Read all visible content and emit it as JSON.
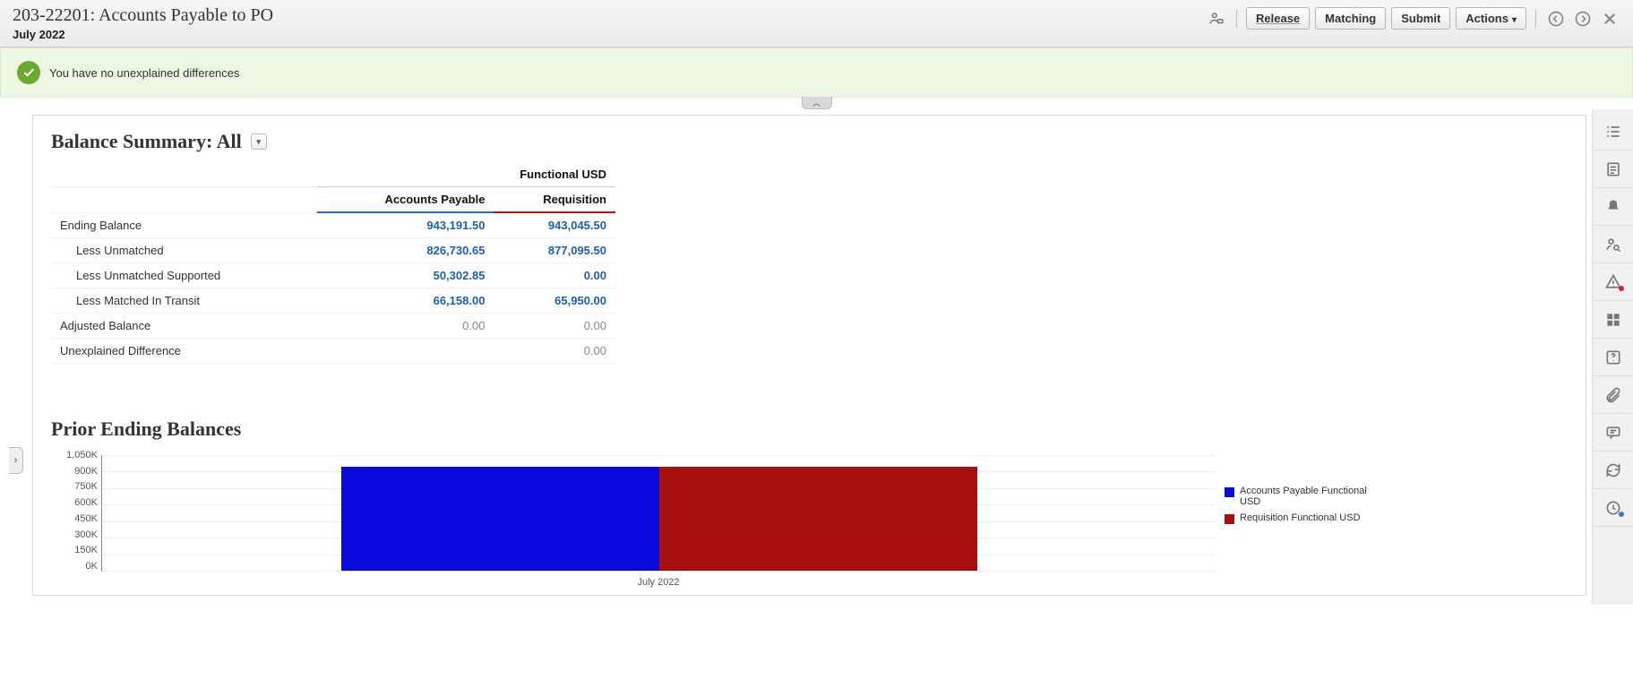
{
  "header": {
    "title": "203-22201: Accounts Payable to PO",
    "period": "July 2022",
    "buttons": {
      "release": "Release",
      "matching": "Matching",
      "submit": "Submit",
      "actions": "Actions"
    }
  },
  "status": {
    "message": "You have no unexplained differences"
  },
  "summary": {
    "title_prefix": "Balance Summary: ",
    "scope": "All",
    "super_header": "Functional USD",
    "col1": "Accounts Payable",
    "col2": "Requisition",
    "rows": [
      {
        "label": "Ending Balance",
        "v1": "943,191.50",
        "v2": "943,045.50",
        "link": true
      },
      {
        "label": "Less Unmatched",
        "v1": "826,730.65",
        "v2": "877,095.50",
        "link": true,
        "indent": true
      },
      {
        "label": "Less Unmatched Supported",
        "v1": "50,302.85",
        "v2": "0.00",
        "link": true,
        "indent": true
      },
      {
        "label": "Less Matched In Transit",
        "v1": "66,158.00",
        "v2": "65,950.00",
        "link": true,
        "indent": true
      },
      {
        "label": "Adjusted Balance",
        "v1": "0.00",
        "v2": "0.00",
        "link": false
      },
      {
        "label": "Unexplained Difference",
        "v1": "",
        "v2": "0.00",
        "link": false
      }
    ]
  },
  "chart_title": "Prior Ending Balances",
  "chart_data": {
    "type": "bar",
    "categories": [
      "July 2022"
    ],
    "series": [
      {
        "name": "Accounts Payable Functional USD",
        "values": [
          943191.5
        ],
        "color": "#0a0adf"
      },
      {
        "name": "Requisition Functional USD",
        "values": [
          943045.5
        ],
        "color": "#a80e0e"
      }
    ],
    "ylim": [
      0,
      1050000
    ],
    "yticks": [
      "1,050K",
      "900K",
      "750K",
      "600K",
      "450K",
      "300K",
      "150K",
      "0K"
    ]
  }
}
